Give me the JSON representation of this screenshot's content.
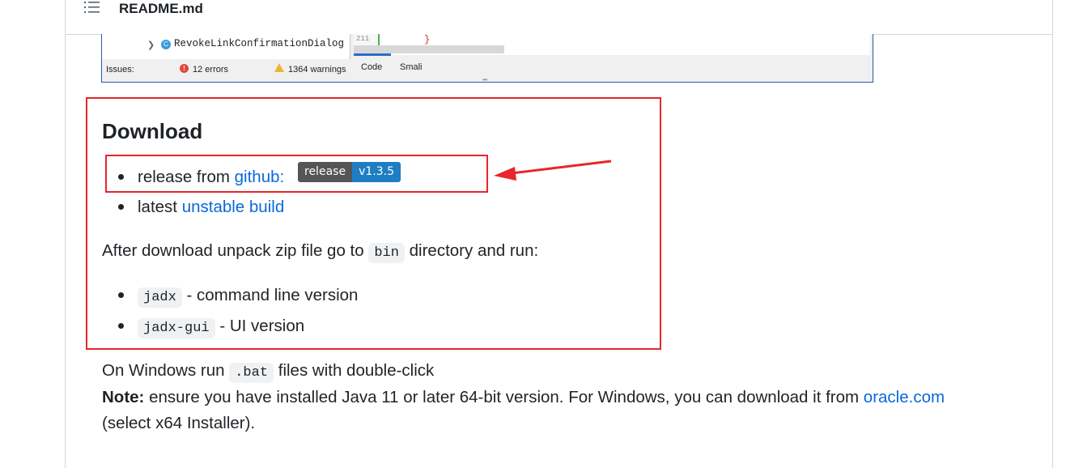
{
  "file_header": {
    "file_name": "README.md",
    "outline_icon": "list-unordered-icon"
  },
  "ide_screenshot": {
    "tree_item": "RevokeLinkConfirmationDialog",
    "line_number": "211",
    "code_text": "}",
    "status": {
      "issues_label": "Issues:",
      "errors": "12 errors",
      "warnings": "1364 warnings"
    },
    "tabs": [
      "Code",
      "Smali"
    ]
  },
  "download": {
    "title": "Download",
    "release": {
      "prefix": "release from ",
      "link_text": "github:",
      "badge_left": "release",
      "badge_right": "v1.3.5"
    },
    "latest": {
      "prefix": "latest ",
      "link_text": "unstable build"
    },
    "after": {
      "before": "After download unpack zip file go to ",
      "code": "bin",
      "after": " directory and run:"
    },
    "commands": [
      {
        "code": "jadx",
        "desc": " - command line version"
      },
      {
        "code": "jadx-gui",
        "desc": " - UI version"
      }
    ]
  },
  "windows": {
    "before": "On Windows run ",
    "code": ".bat",
    "after": " files with double-click"
  },
  "note": {
    "label": "Note:",
    "text": " ensure you have installed Java 11 or later 64-bit version. For Windows, you can download it from ",
    "link_text": "oracle.com",
    "continued": "(select x64 Installer)."
  },
  "colors": {
    "link": "#0969da",
    "highlight_red": "#e8262b",
    "badge_left": "#555555",
    "badge_right": "#1f7ec2"
  }
}
